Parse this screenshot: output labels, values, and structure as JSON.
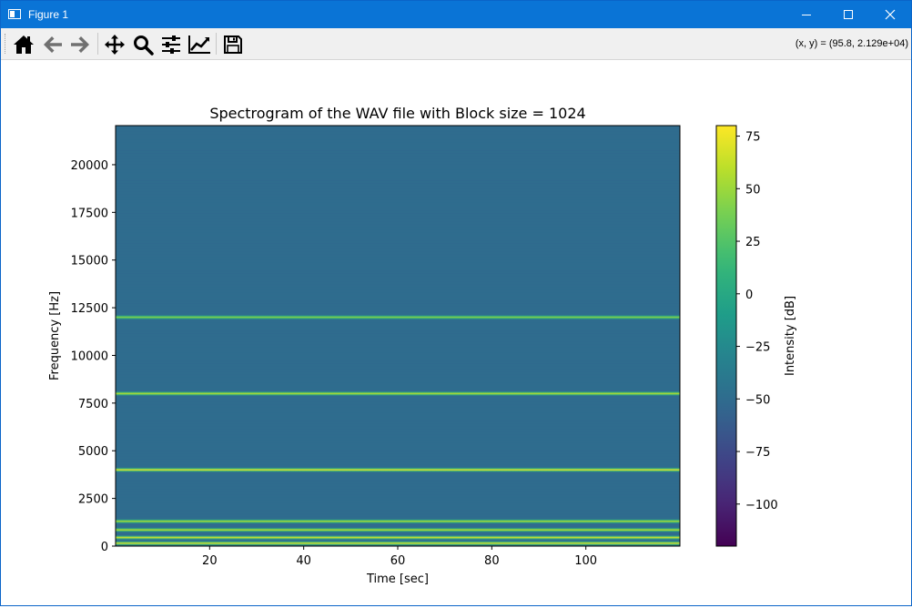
{
  "window": {
    "title": "Figure 1",
    "buttons": [
      "minimize",
      "maximize",
      "close"
    ]
  },
  "toolbar": {
    "tools": [
      {
        "name": "home",
        "icon": "home-icon"
      },
      {
        "name": "back",
        "icon": "back-arrow-icon"
      },
      {
        "name": "forward",
        "icon": "forward-arrow-icon"
      },
      {
        "name": "pan",
        "icon": "pan-move-icon"
      },
      {
        "name": "zoom",
        "icon": "zoom-magnifier-icon"
      },
      {
        "name": "configure-subplots",
        "icon": "sliders-icon"
      },
      {
        "name": "edit-axis",
        "icon": "line-chart-icon"
      },
      {
        "name": "save",
        "icon": "floppy-disk-icon"
      }
    ],
    "coords": "(x, y) = (95.8, 2.129e+04)"
  },
  "chart_data": {
    "type": "heatmap",
    "title": "Spectrogram of the WAV file with Block size = 1024",
    "xlabel": "Time [sec]",
    "ylabel": "Frequency [Hz]",
    "xlim": [
      0,
      120
    ],
    "ylim": [
      0,
      22050
    ],
    "xticks": [
      20,
      40,
      60,
      80,
      100
    ],
    "yticks": [
      0,
      2500,
      5000,
      7500,
      10000,
      12500,
      15000,
      17500,
      20000
    ],
    "background_level_db": -50,
    "bands": [
      {
        "freq_hz": 150,
        "level_db": 70
      },
      {
        "freq_hz": 450,
        "level_db": 70
      },
      {
        "freq_hz": 850,
        "level_db": 60
      },
      {
        "freq_hz": 1300,
        "level_db": 55
      },
      {
        "freq_hz": 4000,
        "level_db": 75
      },
      {
        "freq_hz": 8000,
        "level_db": 60
      },
      {
        "freq_hz": 12000,
        "level_db": 45
      }
    ],
    "colorbar": {
      "label": "Intensity [dB]",
      "colormap": "viridis",
      "range": [
        -120,
        80
      ],
      "ticks": [
        -100,
        -75,
        -50,
        -25,
        0,
        25,
        50,
        75
      ]
    }
  }
}
